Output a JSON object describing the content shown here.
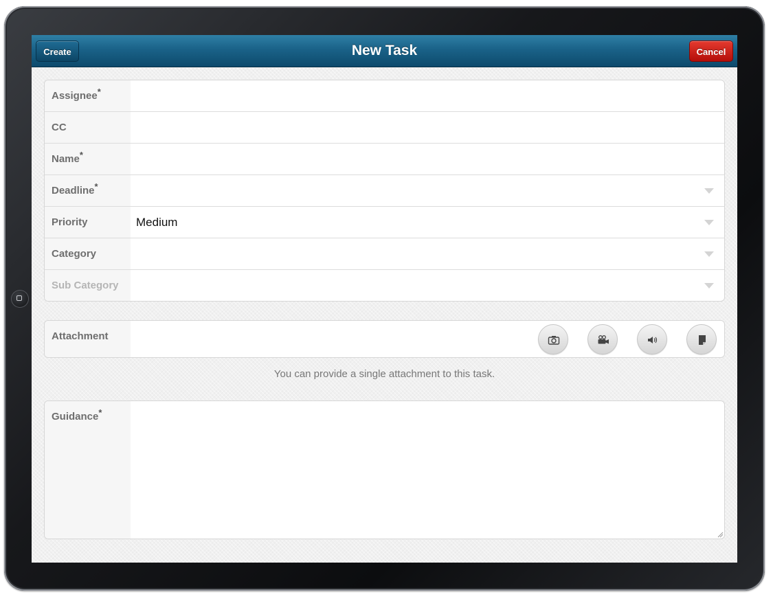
{
  "navbar": {
    "title": "New Task",
    "create_label": "Create",
    "cancel_label": "Cancel"
  },
  "form": {
    "required_marker": "*",
    "fields": [
      {
        "label": "Assignee",
        "required": true,
        "value": "",
        "dropdown": false
      },
      {
        "label": "CC",
        "required": false,
        "value": "",
        "dropdown": false
      },
      {
        "label": "Name",
        "required": true,
        "value": "",
        "dropdown": false
      },
      {
        "label": "Deadline",
        "required": true,
        "value": "",
        "dropdown": true
      },
      {
        "label": "Priority",
        "required": false,
        "value": "Medium",
        "dropdown": true
      },
      {
        "label": "Category",
        "required": false,
        "value": "",
        "dropdown": true
      },
      {
        "label": "Sub Category",
        "required": false,
        "value": "",
        "dropdown": true,
        "disabled": true
      }
    ]
  },
  "attachment": {
    "label": "Attachment",
    "buttons": [
      "camera-icon",
      "video-camera-icon",
      "audio-icon",
      "document-icon"
    ],
    "hint": "You can provide a single attachment to this task."
  },
  "guidance": {
    "label": "Guidance",
    "required": true,
    "value": ""
  },
  "colors": {
    "navbar": "#1a6288",
    "cancel": "#c81f17",
    "label_bg": "#f6f6f6"
  }
}
